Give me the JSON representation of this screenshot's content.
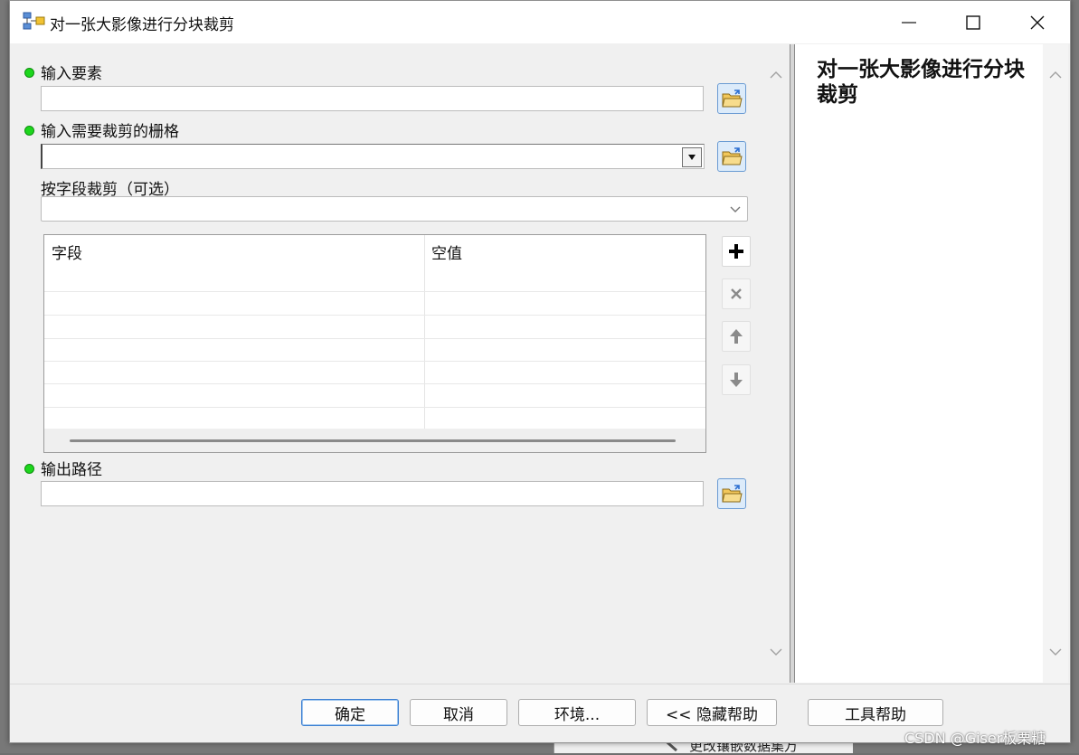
{
  "window": {
    "title": "对一张大影像进行分块裁剪",
    "controls": {
      "minimize": "minimize",
      "maximize": "maximize",
      "close": "close"
    }
  },
  "form": {
    "input_features": {
      "label": "输入要素",
      "value": ""
    },
    "input_raster": {
      "label": "输入需要裁剪的栅格",
      "value": ""
    },
    "clip_by_field": {
      "label": "按字段裁剪（可选）",
      "value": ""
    },
    "field_table": {
      "columns": [
        "字段",
        "空值"
      ],
      "rows": []
    },
    "output_path": {
      "label": "输出路径",
      "value": ""
    }
  },
  "help_panel": {
    "title": "对一张大影像进行分块裁剪"
  },
  "footer": {
    "ok": "确定",
    "cancel": "取消",
    "environments": "环境...",
    "hide_help": "<< 隐藏帮助",
    "tool_help": "工具帮助"
  },
  "background": {
    "partial_text": "更改镶嵌数据集万"
  },
  "watermark": "CSDN @Giser板栗糖",
  "colors": {
    "required_dot": "#1dd61d",
    "default_button_border": "#3c7fd1",
    "browse_button_bg": "#dcebfa"
  },
  "icons": {
    "browse": "open-folder-icon",
    "add": "plus-icon",
    "delete": "x-icon",
    "move_up": "arrow-up-icon",
    "move_down": "arrow-down-icon"
  }
}
